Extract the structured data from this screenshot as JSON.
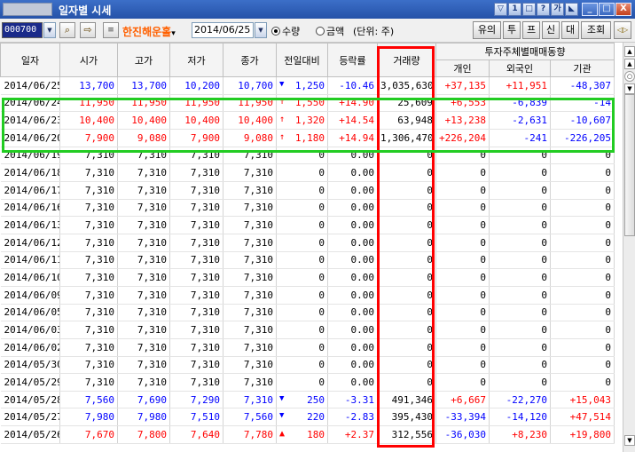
{
  "window": {
    "title": "일자별 시세",
    "title_buttons": [
      "▽",
      "1",
      "□",
      "?",
      "가",
      "◣"
    ],
    "controls": [
      "_",
      "□",
      "X"
    ]
  },
  "toolbar": {
    "stock_code": "000700",
    "stock_name": "한진해운홀",
    "date": "2014/06/25",
    "radio_volume": "수량",
    "radio_amount": "금액",
    "unit": "(단위: 주)",
    "buttons": [
      "유의",
      "투",
      "프",
      "신",
      "대",
      "조회"
    ],
    "dropdown_glyph": "▼",
    "stock_name_glyph": "▾",
    "arrow_glyph": "◁▷",
    "note_glyph": "≡",
    "search_glyph": "⌕",
    "transfer_glyph": "⇨"
  },
  "table": {
    "headers": {
      "date": "일자",
      "open": "시가",
      "high": "고가",
      "low": "저가",
      "close": "종가",
      "change": "전일대비",
      "rate": "등락률",
      "volume": "거래량",
      "investor_group": "투자주체별매매동향",
      "individual": "개인",
      "foreign": "외국인",
      "institution": "기관"
    },
    "rows": [
      {
        "date": "2014/06/25",
        "open": "13,700",
        "high": "13,700",
        "low": "10,200",
        "close": "10,700",
        "dir": "down",
        "change": "1,250",
        "rate": "-10.46",
        "volume": "3,035,630",
        "individual": "+37,135",
        "foreign": "+11,951",
        "institution": "-48,307"
      },
      {
        "date": "2014/06/24",
        "open": "11,950",
        "high": "11,950",
        "low": "11,950",
        "close": "11,950",
        "dir": "up",
        "change": "1,550",
        "rate": "+14.90",
        "volume": "25,609",
        "individual": "+6,553",
        "foreign": "-6,839",
        "institution": "-14"
      },
      {
        "date": "2014/06/23",
        "open": "10,400",
        "high": "10,400",
        "low": "10,400",
        "close": "10,400",
        "dir": "up",
        "change": "1,320",
        "rate": "+14.54",
        "volume": "63,948",
        "individual": "+13,238",
        "foreign": "-2,631",
        "institution": "-10,607"
      },
      {
        "date": "2014/06/20",
        "open": "7,900",
        "high": "9,080",
        "low": "7,900",
        "close": "9,080",
        "dir": "up",
        "change": "1,180",
        "rate": "+14.94",
        "volume": "1,306,470",
        "individual": "+226,204",
        "foreign": "-241",
        "institution": "-226,205"
      },
      {
        "date": "2014/06/19",
        "open": "7,310",
        "high": "7,310",
        "low": "7,310",
        "close": "7,310",
        "dir": "none",
        "change": "0",
        "rate": "0.00",
        "volume": "0",
        "individual": "0",
        "foreign": "0",
        "institution": "0"
      },
      {
        "date": "2014/06/18",
        "open": "7,310",
        "high": "7,310",
        "low": "7,310",
        "close": "7,310",
        "dir": "none",
        "change": "0",
        "rate": "0.00",
        "volume": "0",
        "individual": "0",
        "foreign": "0",
        "institution": "0"
      },
      {
        "date": "2014/06/17",
        "open": "7,310",
        "high": "7,310",
        "low": "7,310",
        "close": "7,310",
        "dir": "none",
        "change": "0",
        "rate": "0.00",
        "volume": "0",
        "individual": "0",
        "foreign": "0",
        "institution": "0"
      },
      {
        "date": "2014/06/16",
        "open": "7,310",
        "high": "7,310",
        "low": "7,310",
        "close": "7,310",
        "dir": "none",
        "change": "0",
        "rate": "0.00",
        "volume": "0",
        "individual": "0",
        "foreign": "0",
        "institution": "0"
      },
      {
        "date": "2014/06/13",
        "open": "7,310",
        "high": "7,310",
        "low": "7,310",
        "close": "7,310",
        "dir": "none",
        "change": "0",
        "rate": "0.00",
        "volume": "0",
        "individual": "0",
        "foreign": "0",
        "institution": "0"
      },
      {
        "date": "2014/06/12",
        "open": "7,310",
        "high": "7,310",
        "low": "7,310",
        "close": "7,310",
        "dir": "none",
        "change": "0",
        "rate": "0.00",
        "volume": "0",
        "individual": "0",
        "foreign": "0",
        "institution": "0"
      },
      {
        "date": "2014/06/11",
        "open": "7,310",
        "high": "7,310",
        "low": "7,310",
        "close": "7,310",
        "dir": "none",
        "change": "0",
        "rate": "0.00",
        "volume": "0",
        "individual": "0",
        "foreign": "0",
        "institution": "0"
      },
      {
        "date": "2014/06/10",
        "open": "7,310",
        "high": "7,310",
        "low": "7,310",
        "close": "7,310",
        "dir": "none",
        "change": "0",
        "rate": "0.00",
        "volume": "0",
        "individual": "0",
        "foreign": "0",
        "institution": "0"
      },
      {
        "date": "2014/06/09",
        "open": "7,310",
        "high": "7,310",
        "low": "7,310",
        "close": "7,310",
        "dir": "none",
        "change": "0",
        "rate": "0.00",
        "volume": "0",
        "individual": "0",
        "foreign": "0",
        "institution": "0"
      },
      {
        "date": "2014/06/05",
        "open": "7,310",
        "high": "7,310",
        "low": "7,310",
        "close": "7,310",
        "dir": "none",
        "change": "0",
        "rate": "0.00",
        "volume": "0",
        "individual": "0",
        "foreign": "0",
        "institution": "0"
      },
      {
        "date": "2014/06/03",
        "open": "7,310",
        "high": "7,310",
        "low": "7,310",
        "close": "7,310",
        "dir": "none",
        "change": "0",
        "rate": "0.00",
        "volume": "0",
        "individual": "0",
        "foreign": "0",
        "institution": "0"
      },
      {
        "date": "2014/06/02",
        "open": "7,310",
        "high": "7,310",
        "low": "7,310",
        "close": "7,310",
        "dir": "none",
        "change": "0",
        "rate": "0.00",
        "volume": "0",
        "individual": "0",
        "foreign": "0",
        "institution": "0"
      },
      {
        "date": "2014/05/30",
        "open": "7,310",
        "high": "7,310",
        "low": "7,310",
        "close": "7,310",
        "dir": "none",
        "change": "0",
        "rate": "0.00",
        "volume": "0",
        "individual": "0",
        "foreign": "0",
        "institution": "0"
      },
      {
        "date": "2014/05/29",
        "open": "7,310",
        "high": "7,310",
        "low": "7,310",
        "close": "7,310",
        "dir": "none",
        "change": "0",
        "rate": "0.00",
        "volume": "0",
        "individual": "0",
        "foreign": "0",
        "institution": "0"
      },
      {
        "date": "2014/05/28",
        "open": "7,560",
        "high": "7,690",
        "low": "7,290",
        "close": "7,310",
        "dir": "down",
        "change": "250",
        "rate": "-3.31",
        "volume": "491,346",
        "individual": "+6,667",
        "foreign": "-22,270",
        "institution": "+15,043"
      },
      {
        "date": "2014/05/27",
        "open": "7,980",
        "high": "7,980",
        "low": "7,510",
        "close": "7,560",
        "dir": "down",
        "change": "220",
        "rate": "-2.83",
        "volume": "395,430",
        "individual": "-33,394",
        "foreign": "-14,120",
        "institution": "+47,514"
      },
      {
        "date": "2014/05/26",
        "open": "7,670",
        "high": "7,800",
        "low": "7,640",
        "close": "7,780",
        "dir": "up-tri",
        "change": "180",
        "rate": "+2.37",
        "volume": "312,556",
        "individual": "-36,030",
        "foreign": "+8,230",
        "institution": "+19,800"
      }
    ]
  },
  "colors": {
    "up": "#ff0000",
    "down": "#0000ff",
    "volume_highlight": "#ff0000",
    "rows_highlight": "#22cc22"
  }
}
